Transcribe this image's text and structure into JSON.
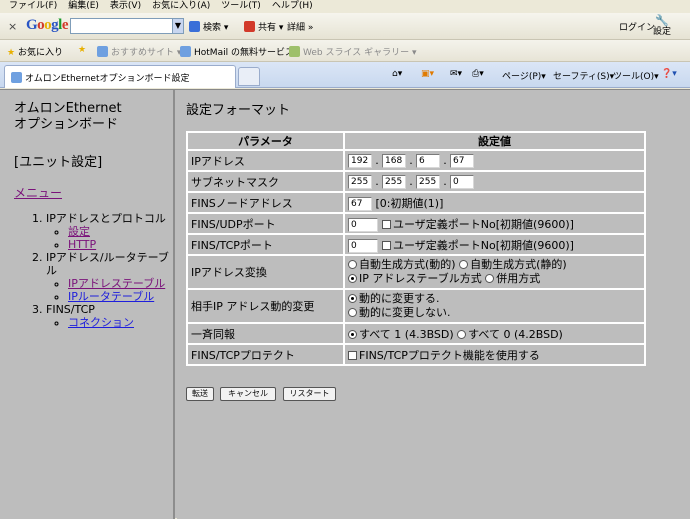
{
  "menu_bar": [
    "ファイル(F)",
    "編集(E)",
    "表示(V)",
    "お気に入り(A)",
    "ツール(T)",
    "ヘルプ(H)"
  ],
  "google_toolbar": {
    "close": "×",
    "logo": [
      "G",
      "o",
      "o",
      "g",
      "l",
      "e"
    ],
    "search_placeholder": "",
    "search_button": "検索",
    "share": "共有",
    "more": "詳細 »",
    "login": "ログイン",
    "settings": "設定"
  },
  "favorites_bar": {
    "favorites": "お気に入り",
    "suggested_sites": "おすすめサイト",
    "hotmail": "HotMail の無料サービス",
    "web_slice": "Web スライス ギャラリー"
  },
  "tab": {
    "title": "オムロンEthernetオプションボード設定"
  },
  "command_bar": {
    "page": "ページ(P)",
    "safety": "セーフティ(S)",
    "tools": "ツール(O)"
  },
  "sidebar": {
    "title": "オムロンEthernet\nオプションボード",
    "unit": "[ユニット設定]",
    "menu": "メニュー",
    "sections": [
      {
        "num": "1.",
        "label": "IPアドレスとプロトコル",
        "links": [
          "設定",
          "HTTP"
        ]
      },
      {
        "num": "2.",
        "label": "IPアドレス/ルータテーブル",
        "links": [
          "IPアドレステーブル",
          "IPルータテーブル"
        ]
      },
      {
        "num": "3.",
        "label": "FINS/TCP",
        "links": [
          "コネクション"
        ]
      }
    ]
  },
  "main": {
    "heading": "設定フォーマット",
    "col_param": "パラメータ",
    "col_value": "設定値",
    "rows": {
      "ip": {
        "label": "IPアドレス",
        "v1": "192",
        "v2": "168",
        "v3": "6",
        "v4": "67"
      },
      "mask": {
        "label": "サブネットマスク",
        "v1": "255",
        "v2": "255",
        "v3": "255",
        "v4": "0"
      },
      "fins_node": {
        "label": "FINSノードアドレス",
        "value": "67",
        "note": "[0:初期値(1)]"
      },
      "fins_udp": {
        "label": "FINS/UDPポート",
        "value": "0",
        "note": "ユーザ定義ポートNo[初期値(9600)]"
      },
      "fins_tcp": {
        "label": "FINS/TCPポート",
        "value": "0",
        "note": "ユーザ定義ポートNo[初期値(9600)]"
      },
      "ip_conv": {
        "label": "IPアドレス変換",
        "o1": "自動生成方式(動的)",
        "o2": "自動生成方式(静的)",
        "o3": "IP アドレステーブル方式",
        "o4": "併用方式"
      },
      "dyn": {
        "label": "相手IP アドレス動的変更",
        "o1": "動的に変更する.",
        "o2": "動的に変更しない."
      },
      "broadcast": {
        "label": "一斉同報",
        "o1": "すべて 1 (4.3BSD)",
        "o2": "すべて 0 (4.2BSD)"
      },
      "protect": {
        "label": "FINS/TCPプロテクト",
        "note": "FINS/TCPプロテクト機能を使用する"
      }
    },
    "buttons": {
      "send": "転送",
      "cancel": "キャンセル",
      "restart": "リスタート"
    }
  }
}
